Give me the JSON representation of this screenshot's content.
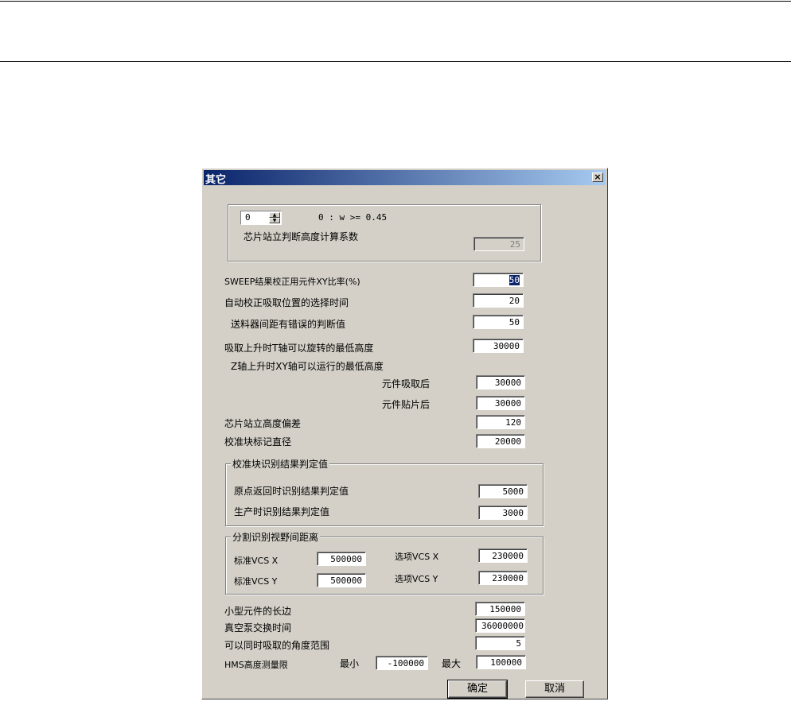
{
  "dialog": {
    "title": "其它",
    "close_glyph": "×"
  },
  "stand_group": {
    "spinner_value": "0",
    "spinner_desc": "0 : w >= 0.45",
    "coef_label": "芯片站立判断高度计算系数",
    "coef_value": "25"
  },
  "settings": {
    "sweep_label": "SWEEP结果校正用元件XY比率(%)",
    "sweep_value": "50",
    "auto_time_label": "自动校正吸取位置的选择时间",
    "auto_time_value": "20",
    "feeder_label": "送料器间距有错误的判断值",
    "feeder_value": "50",
    "t_axis_label": "吸取上升时T轴可以旋转的最低高度",
    "t_axis_value": "30000",
    "z_axis_label": "Z轴上升时XY轴可以运行的最低高度",
    "after_pick_label": "元件吸取后",
    "after_pick_value": "30000",
    "after_place_label": "元件贴片后",
    "after_place_value": "30000",
    "stand_dev_label": "芯片站立高度偏差",
    "stand_dev_value": "120",
    "mark_diam_label": "校准块标记直径",
    "mark_diam_value": "20000"
  },
  "calib_group": {
    "title": "校准块识别结果判定值",
    "origin_label": "原点返回时识别结果判定值",
    "origin_value": "5000",
    "prod_label": "生产时识别结果判定值",
    "prod_value": "3000"
  },
  "split_group": {
    "title": "分割识别视野间距离",
    "std_x_label": "标准VCS X",
    "std_x_value": "500000",
    "opt_x_label": "选项VCS X",
    "opt_x_value": "230000",
    "std_y_label": "标准VCS Y",
    "std_y_value": "500000",
    "opt_y_label": "选项VCS Y",
    "opt_y_value": "230000"
  },
  "bottom": {
    "long_side_label": "小型元件的长边",
    "long_side_value": "150000",
    "vacuum_label": "真空泵交换时间",
    "vacuum_value": "36000000",
    "angle_label": "可以同时吸取的角度范围",
    "angle_value": "5",
    "hms_label": "HMS高度测量限",
    "min_label": "最小",
    "min_value": "-100000",
    "max_label": "最大",
    "max_value": "100000"
  },
  "buttons": {
    "ok": "确定",
    "cancel": "取消"
  }
}
